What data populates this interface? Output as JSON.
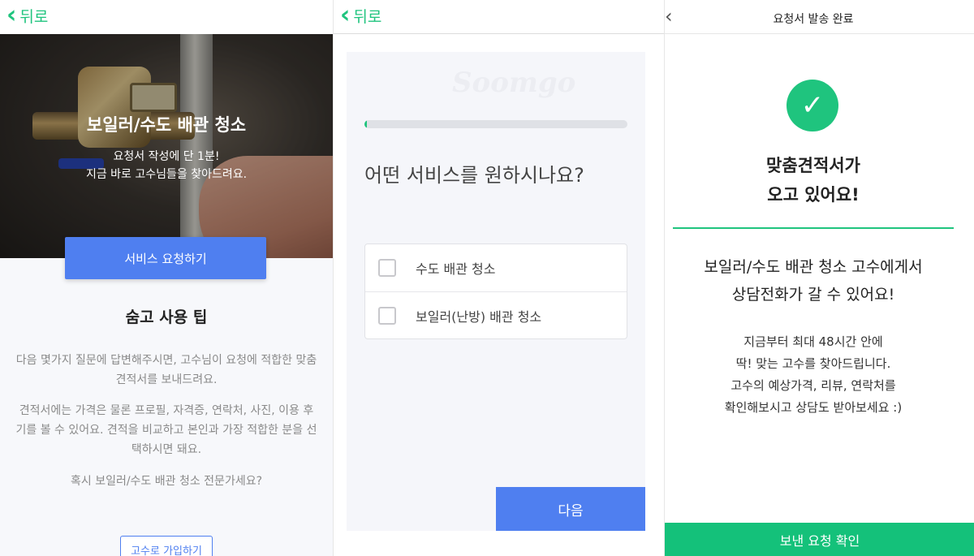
{
  "screen1": {
    "back_label": "뒤로",
    "hero": {
      "title": "보일러/수도 배관 청소",
      "subtitle_line1": "요청서 작성에 단 1분!",
      "subtitle_line2": "지금 바로 고수님들을 찾아드려요."
    },
    "request_button": "서비스 요청하기",
    "tips_title": "숨고 사용 팁",
    "tip1": "다음 몇가지 질문에 답변해주시면, 고수님이 요청에 적합한 맞춤 견적서를 보내드려요.",
    "tip2": "견적서에는 가격은 물론 프로필, 자격증, 연락처, 사진, 이용 후기를 볼 수 있어요. 견적을 비교하고 본인과 가장 적합한 분을 선택하시면 돼요.",
    "tip3": "혹시 보일러/수도 배관 청소 전문가세요?",
    "join_button": "고수로 가입하기"
  },
  "screen2": {
    "back_label": "뒤로",
    "watermark": "Soomgo",
    "progress_fraction": 0.01,
    "question": "어떤 서비스를 원하시나요?",
    "options": [
      {
        "label": "수도 배관 청소"
      },
      {
        "label": "보일러(난방) 배관 청소"
      }
    ],
    "next_button": "다음"
  },
  "screen3": {
    "title": "요청서 발송 완료",
    "headline_line1": "맞춤견적서가",
    "headline_line2": "오고 있어요!",
    "sub_line1": "보일러/수도 배관 청소 고수에게서",
    "sub_line2": "상담전화가 갈 수 있어요!",
    "body_lines": [
      "지금부터 최대 48시간 안에",
      "딱! 맞는 고수를 찾아드립니다.",
      "고수의 예상가격, 리뷰, 연락처를",
      "확인해보시고 상담도 받아보세요 :)"
    ],
    "confirm_button": "보낸 요청 확인"
  },
  "icons": {
    "back": "chevron-left-icon",
    "success": "check-circle-icon",
    "checkbox": "checkbox-icon"
  },
  "colors": {
    "green": "#1fc47e",
    "blue": "#4f7ff0"
  }
}
